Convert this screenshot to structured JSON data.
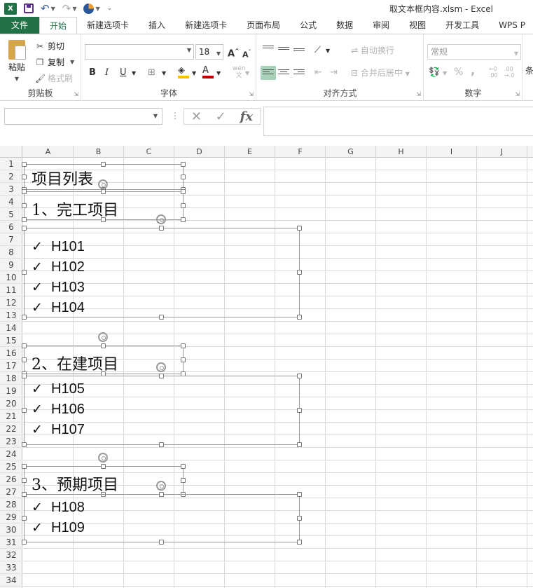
{
  "window": {
    "title": "取文本框内容.xlsm - Excel",
    "app_logo": "X"
  },
  "quick_access": {
    "icons": [
      "excel-logo-icon",
      "save-icon",
      "undo-icon",
      "redo-icon",
      "chart-icon",
      "customize-icon"
    ]
  },
  "tabs": [
    "文件",
    "开始",
    "新建选项卡",
    "插入",
    "新建选项卡",
    "页面布局",
    "公式",
    "数据",
    "审阅",
    "视图",
    "开发工具",
    "WPS P"
  ],
  "active_tab": "开始",
  "ribbon": {
    "clipboard": {
      "label": "剪贴板",
      "paste": "粘贴",
      "cut": "剪切",
      "copy": "复制",
      "format_painter": "格式刷"
    },
    "font": {
      "label": "字体",
      "font_name": "",
      "font_size": "18",
      "grow": "A",
      "shrink": "A",
      "bold": "B",
      "italic": "I",
      "underline": "U",
      "font_color": "A",
      "phonetic": "wén"
    },
    "alignment": {
      "label": "对齐方式",
      "wrap_text": "自动换行",
      "merge_center": "合并后居中"
    },
    "number": {
      "label": "数字",
      "format": "常规",
      "percent": "%",
      "comma": ",",
      "inc_decimal": "←0 .00",
      "dec_decimal": ".00 →.0"
    },
    "edge_partial": "条"
  },
  "formula_bar": {
    "name_box": "",
    "cancel": "✕",
    "confirm": "✓",
    "fx": "fx",
    "content": ""
  },
  "columns": [
    "A",
    "B",
    "C",
    "D",
    "E",
    "F",
    "G",
    "H",
    "I",
    "J"
  ],
  "rows": [
    "1",
    "2",
    "3",
    "4",
    "5",
    "6",
    "7",
    "8",
    "9",
    "10",
    "11",
    "12",
    "13",
    "14",
    "15",
    "16",
    "17",
    "18",
    "19",
    "20",
    "21",
    "22",
    "23",
    "24",
    "25",
    "26",
    "27",
    "28",
    "29",
    "30",
    "31",
    "32",
    "33",
    "34"
  ],
  "text_boxes": {
    "title": "项目列表",
    "section1": {
      "heading": "1、完工项目",
      "items": [
        "H101",
        "H102",
        "H103",
        "H104"
      ]
    },
    "section2": {
      "heading": "2、在建项目",
      "items": [
        "H105",
        "H106",
        "H107"
      ]
    },
    "section3": {
      "heading": "3、预期项目",
      "items": [
        "H108",
        "H109"
      ]
    }
  },
  "check_mark": "✓",
  "colors": {
    "file_tab": "#217346",
    "active_tab_text": "#217346",
    "selected_align": "#a9d3b8",
    "font_color_bar": "#c00000",
    "fill_color_bar": "#ffc000"
  }
}
